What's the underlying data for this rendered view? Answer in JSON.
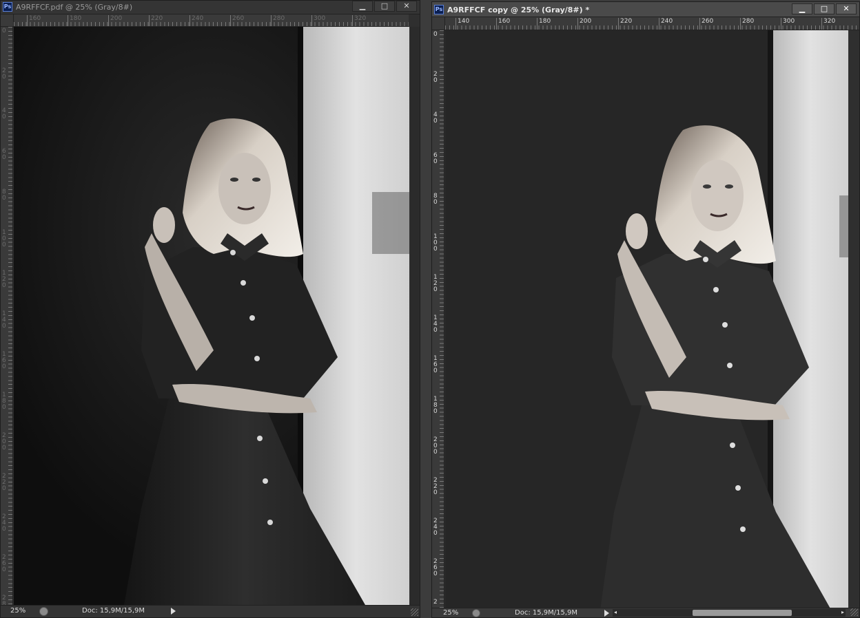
{
  "app": {
    "icon_label": "Ps"
  },
  "windows": [
    {
      "title": "A9RFFCF.pdf @ 25% (Gray/8#)",
      "controls": {
        "minimize": "▁",
        "maximize": "□",
        "close": "✕"
      },
      "ruler_h": [
        "160",
        "180",
        "200",
        "220",
        "240",
        "260",
        "280",
        "300",
        "320"
      ],
      "ruler_v": [
        "0",
        "20",
        "40",
        "60",
        "80",
        "100",
        "120",
        "140",
        "160",
        "180",
        "200",
        "220",
        "240",
        "260",
        "280"
      ],
      "zoom": "25%",
      "doc_info": "Doc: 15,9M/15,9M"
    },
    {
      "title": "A9RFFCF copy @ 25% (Gray/8#) *",
      "controls": {
        "minimize": "▁",
        "maximize": "□",
        "close": "✕"
      },
      "ruler_h": [
        "140",
        "160",
        "180",
        "200",
        "220",
        "240",
        "260",
        "280",
        "300",
        "320"
      ],
      "ruler_v": [
        "0",
        "20",
        "40",
        "60",
        "80",
        "100",
        "120",
        "140",
        "160",
        "180",
        "200",
        "220",
        "240",
        "260",
        "2"
      ],
      "zoom": "25%",
      "doc_info": "Doc: 15,9M/15,9M",
      "scroll_left": "◂",
      "scroll_right": "▸"
    }
  ]
}
